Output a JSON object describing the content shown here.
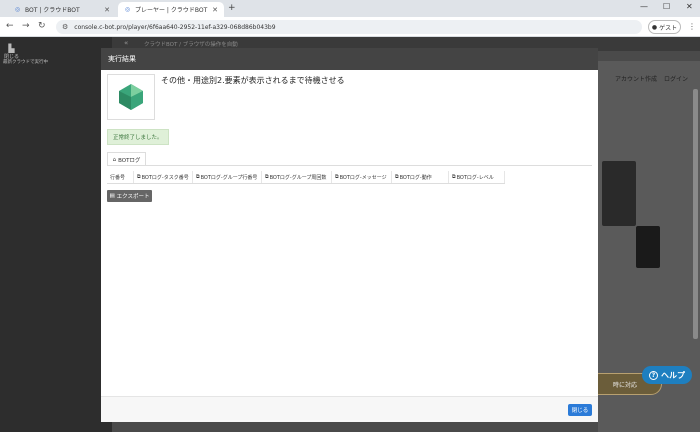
{
  "browser": {
    "tabs": [
      {
        "title": "BOT | クラウドBOT",
        "active": false
      },
      {
        "title": "プレーヤー | クラウドBOT",
        "active": true
      }
    ],
    "new_tab": "+",
    "url": "console.c-bot.pro/player/6f6aa640-2952-11ef-a329-068d86b043b9",
    "guest_label": "ゲスト",
    "window_controls": {
      "minimize": "—",
      "maximize": "☐",
      "close": "✕"
    }
  },
  "page": {
    "leftbar": {
      "close_label": "閉じる",
      "sub_label": "最新クラウドで実行中"
    },
    "breadcrumb": "クラウドBOT  /  ブラウザの操作を自動",
    "right_nav": {
      "signup": "アカウント作成",
      "login": "ログイン"
    },
    "banner_text": "時に対応",
    "help_label": "ヘルプ"
  },
  "modal": {
    "header": "実行結果",
    "bot_title": "その他・用途別2.要素が表示されるまで待機させる",
    "status": "正常終了しました。",
    "tab_label": "BOTログ",
    "columns": [
      "行番号",
      "BOTログ-タスク番号",
      "BOTログ-グループ行番号",
      "BOTログ-グループ周回数",
      "BOTログ-メッセージ",
      "BOTログ-動作",
      "BOTログ-レベル"
    ],
    "export_label": "エクスポート",
    "close_label": "閉じる"
  },
  "colors": {
    "accent": "#2b7bd8",
    "success_bg": "#dff0d8",
    "header_bg": "#444444",
    "help_bg": "#1e7fc0",
    "logo_green": "#3aa57a"
  }
}
